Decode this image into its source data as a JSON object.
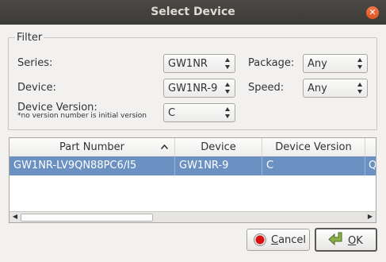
{
  "window": {
    "title": "Select Device"
  },
  "filter": {
    "group_title": "Filter",
    "series_label": "Series:",
    "series_value": "GW1NR",
    "package_label": "Package:",
    "package_value": "Any",
    "device_label": "Device:",
    "device_value": "GW1NR-9",
    "speed_label": "Speed:",
    "speed_value": "Any",
    "device_version_label": "Device Version:",
    "device_version_note": "*no version number is initial version",
    "device_version_value": "C"
  },
  "table": {
    "columns": [
      "Part Number",
      "Device",
      "Device Version",
      ""
    ],
    "sort_indicator": "^",
    "rows": [
      {
        "part_number": "GW1NR-LV9QN88PC6/I5",
        "device": "GW1NR-9",
        "device_version": "C",
        "extra": "Q"
      }
    ]
  },
  "buttons": {
    "cancel_mnemonic": "C",
    "cancel_rest": "ancel",
    "ok_mnemonic": "O",
    "ok_rest": "K"
  },
  "colors": {
    "selection": "#6b91c3",
    "titlebar": "#3c3b37",
    "close": "#e9561f"
  },
  "icons": {
    "close": "close-icon",
    "cancel": "stop-icon",
    "ok": "ok-arrow-icon"
  }
}
